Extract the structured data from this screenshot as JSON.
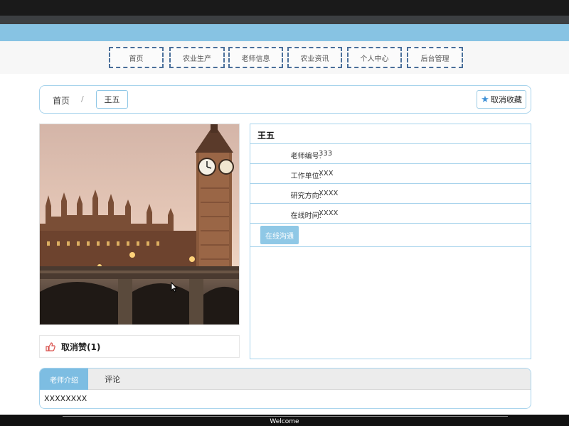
{
  "nav": {
    "items": [
      {
        "label": "首页"
      },
      {
        "label": "农业生产"
      },
      {
        "label": "老师信息"
      },
      {
        "label": "农业资讯"
      },
      {
        "label": "个人中心"
      },
      {
        "label": "后台管理"
      }
    ]
  },
  "breadcrumb": {
    "home": "首页",
    "separator": "/",
    "current": "王五"
  },
  "favorite_button": "取消收藏",
  "like": {
    "label": "取消赞(1)"
  },
  "teacher": {
    "name": "王五",
    "fields": [
      {
        "label": "老师编号:",
        "value": "333"
      },
      {
        "label": "工作单位:",
        "value": "XXX"
      },
      {
        "label": "研究方向:",
        "value": "XXXX"
      },
      {
        "label": "在线时间:",
        "value": "XXXX"
      }
    ],
    "chat_button": "在线沟通"
  },
  "tabs": {
    "items": [
      "老师介绍",
      "评论"
    ],
    "content": "XXXXXXXX"
  },
  "footer": {
    "welcome": "Welcome"
  },
  "colors": {
    "accent": "#87c3e3",
    "tab_active": "#7dbde2",
    "nav_border": "#4a6f9a"
  }
}
